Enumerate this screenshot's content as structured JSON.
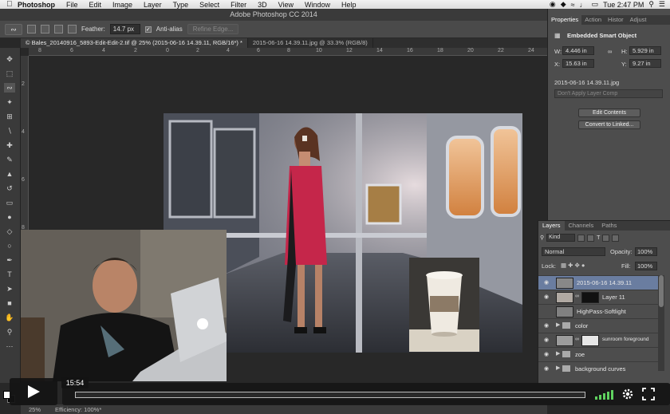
{
  "menubar": {
    "app_name": "Photoshop",
    "items": [
      "File",
      "Edit",
      "Image",
      "Layer",
      "Type",
      "Select",
      "Filter",
      "3D",
      "View",
      "Window",
      "Help"
    ],
    "clock": "Tue 2:47 PM"
  },
  "window": {
    "title": "Adobe Photoshop CC 2014"
  },
  "options_bar": {
    "feather_label": "Feather:",
    "feather_value": "14.7 px",
    "anti_alias_label": "Anti-alias",
    "refine_edge_label": "Refine Edge..."
  },
  "document_tabs": [
    {
      "label": "© Bales_20140916_5893-Edit-Edit-2.tif @ 25% (2015-06-16 14.39.11, RGB/16*) *",
      "active": true
    },
    {
      "label": "2015-06-16 14.39.11.jpg @ 33.3% (RGB/8)",
      "active": false
    }
  ],
  "ruler_top_ticks": [
    "8",
    "6",
    "4",
    "2",
    "0",
    "2",
    "4",
    "6",
    "8",
    "10",
    "12",
    "14",
    "16",
    "18",
    "20",
    "22",
    "24"
  ],
  "ruler_left_ticks": [
    "2",
    "4",
    "6",
    "8",
    "10",
    "12"
  ],
  "properties": {
    "tabs": [
      "Properties",
      "Action",
      "Histor",
      "Adjust"
    ],
    "header": "Embedded Smart Object",
    "w_label": "W:",
    "w_value": "4.446 in",
    "h_label": "H:",
    "h_value": "5.929 in",
    "x_label": "X:",
    "x_value": "15.63 in",
    "y_label": "Y:",
    "y_value": "9.27 in",
    "file_name": "2015-06-16 14.39.11.jpg",
    "layer_comp": "Don't Apply Layer Comp",
    "edit_contents_label": "Edit Contents",
    "convert_label": "Convert to Linked..."
  },
  "layers_panel": {
    "tabs": [
      "Layers",
      "Channels",
      "Paths"
    ],
    "kind_label": "Kind",
    "blend_mode": "Normal",
    "opacity_label": "Opacity:",
    "opacity_value": "100%",
    "lock_label": "Lock:",
    "fill_label": "Fill:",
    "fill_value": "100%",
    "layers": [
      {
        "name": "2015-06-16 14.39.11",
        "type": "smart",
        "selected": true,
        "visible": true
      },
      {
        "name": "Layer 11",
        "type": "masked",
        "selected": false,
        "visible": true
      },
      {
        "name": "HighPass-Softlight",
        "type": "pixel",
        "selected": false,
        "visible": false
      },
      {
        "name": "color",
        "type": "group",
        "selected": false,
        "visible": true
      },
      {
        "name": "sunroom foreground",
        "type": "masked",
        "selected": false,
        "visible": true
      },
      {
        "name": "zoe",
        "type": "group",
        "selected": false,
        "visible": true
      },
      {
        "name": "background curves",
        "type": "group",
        "selected": false,
        "visible": true
      }
    ]
  },
  "status_bar": {
    "zoom": "25%",
    "efficiency": "Efficiency: 100%*"
  },
  "video_player": {
    "timestamp": "15:54",
    "progress_fraction": 0.0,
    "accent": "#00adef"
  }
}
